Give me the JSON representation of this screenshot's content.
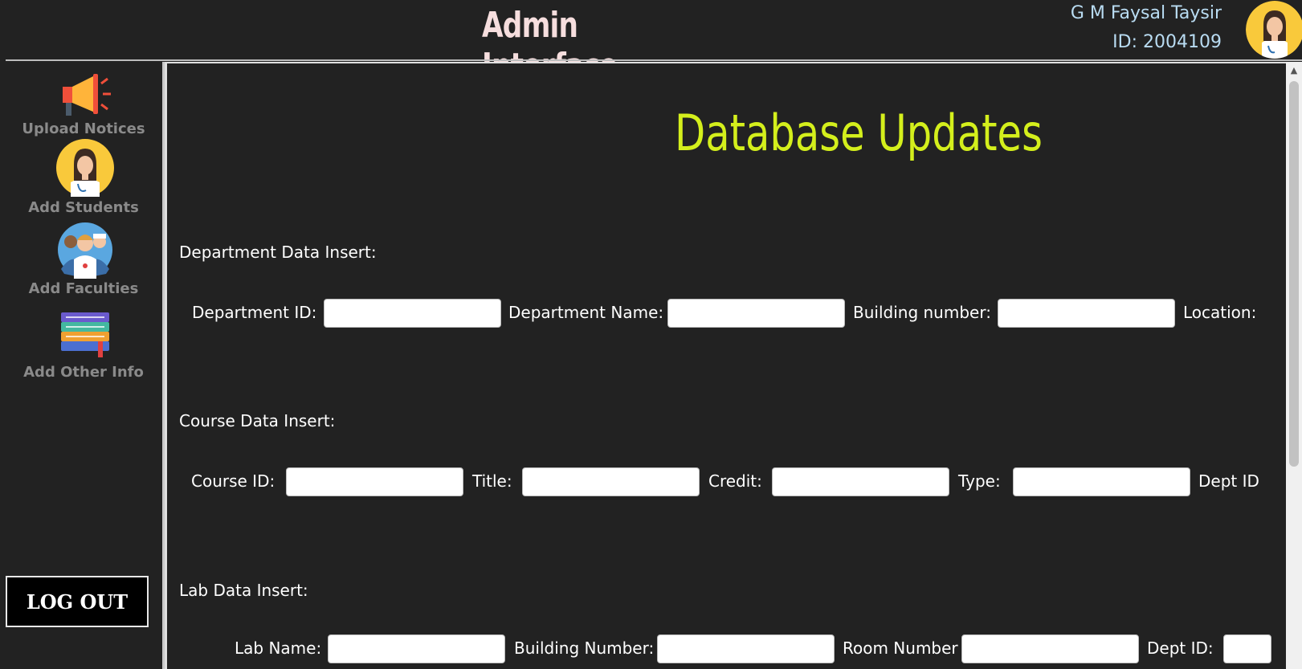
{
  "header": {
    "title": "Admin Interface",
    "user_name": "G M Faysal Taysir",
    "user_id": "ID: 2004109"
  },
  "sidebar": {
    "items": [
      {
        "label": "Upload Notices",
        "icon": "megaphone-icon"
      },
      {
        "label": "Add Students",
        "icon": "student-avatar-icon"
      },
      {
        "label": "Add Faculties",
        "icon": "faculty-group-icon"
      },
      {
        "label": "Add Other Info",
        "icon": "books-icon"
      }
    ],
    "logout_label": "LOG OUT"
  },
  "main": {
    "heading": "Database Updates",
    "department": {
      "title": "Department Data Insert:",
      "labels": [
        "Department ID:",
        "Department Name:",
        "Building number:",
        "Location:"
      ]
    },
    "course": {
      "title": "Course Data Insert:",
      "labels": [
        "Course ID:",
        "Title:",
        "Credit:",
        "Type:",
        "Dept ID"
      ]
    },
    "lab": {
      "title": "Lab Data Insert:",
      "labels": [
        "Lab Name:",
        "Building Number:",
        "Room Number",
        "Dept ID:"
      ]
    }
  },
  "colors": {
    "background": "#222222",
    "heading": "#d4ef1c",
    "title": "#f6dede",
    "user_text": "#b9dcf2",
    "sidebar_label": "#8a8a8a"
  }
}
